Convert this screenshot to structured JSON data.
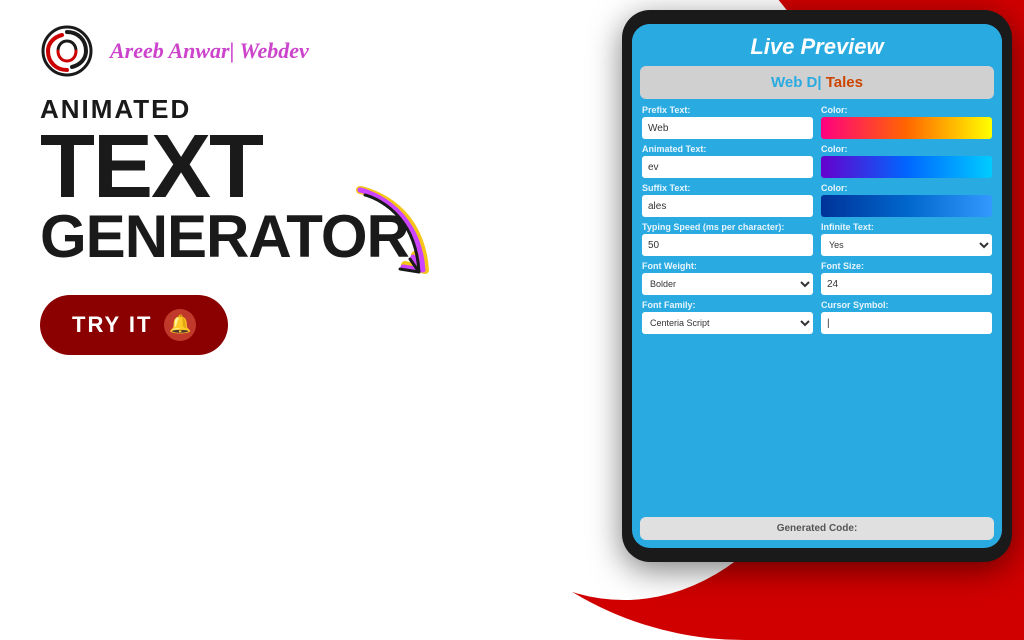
{
  "background": {
    "main_color": "#ffffff",
    "red_color": "#d10000"
  },
  "brand": {
    "name": "Areeb Anwar| Webdev"
  },
  "headline": {
    "line1": "ANIMATED",
    "line2": "TEXT",
    "line3": "GENERATOR"
  },
  "cta": {
    "label": "TRY IT"
  },
  "tablet": {
    "header": "Live Preview",
    "preview_web": "Web D|",
    "preview_tales": " Tales",
    "fields": [
      {
        "label": "Prefix Text:",
        "value": "Web",
        "color_type": "pink"
      },
      {
        "label": "Animated Text:",
        "value": "ev",
        "color_type": "purple"
      },
      {
        "label": "Suffix Text:",
        "value": "ales",
        "color_type": "blue"
      }
    ],
    "typing_speed_label": "Typing Speed (ms per character):",
    "typing_speed_value": "50",
    "infinite_text_label": "Infinite Text:",
    "infinite_text_value": "Yes",
    "font_weight_label": "Font Weight:",
    "font_weight_value": "Bolder",
    "font_size_label": "Font Size:",
    "font_size_value": "24",
    "font_family_label": "Font Family:",
    "font_family_value": "Centeria Script",
    "cursor_symbol_label": "Cursor Symbol:",
    "cursor_symbol_value": "|",
    "generated_code": "Generated Code:"
  }
}
